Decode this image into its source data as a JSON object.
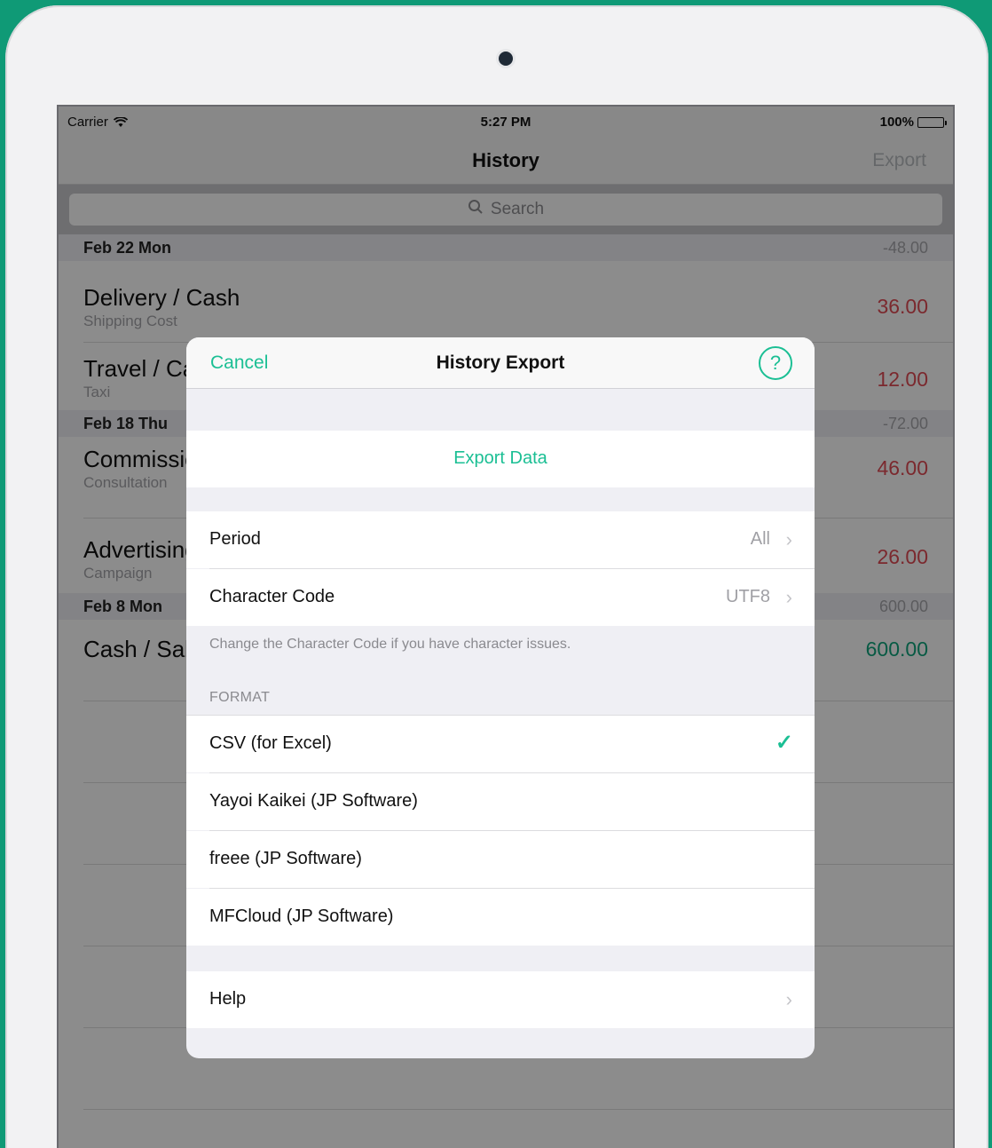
{
  "status_bar": {
    "carrier": "Carrier",
    "time": "5:27 PM",
    "battery": "100%"
  },
  "nav": {
    "title": "History",
    "export_label": "Export"
  },
  "search": {
    "placeholder": "Search"
  },
  "history": {
    "sections": [
      {
        "date": "Feb 22 Mon",
        "sum": "-48.00",
        "rows": [
          {
            "title": "Delivery / Cash",
            "sub": "Shipping Cost",
            "amount": "36.00"
          },
          {
            "title": "Travel / Ca",
            "sub": "Taxi",
            "amount": "12.00"
          }
        ]
      },
      {
        "date": "Feb 18 Thu",
        "sum": "-72.00",
        "rows": [
          {
            "title": "Commissio",
            "sub": "Consultation",
            "amount": "46.00"
          },
          {
            "title": "Advertising",
            "sub": "Campaign",
            "amount": "26.00"
          }
        ]
      },
      {
        "date": "Feb 8 Mon",
        "sum": "600.00",
        "rows": [
          {
            "title": "Cash / Sale",
            "sub": "",
            "amount": "600.00"
          }
        ]
      }
    ]
  },
  "modal": {
    "cancel_label": "Cancel",
    "title": "History Export",
    "help_icon_glyph": "?",
    "export_data_label": "Export Data",
    "period_label": "Period",
    "period_value": "All",
    "char_code_label": "Character Code",
    "char_code_value": "UTF8",
    "char_code_footnote": "Change the Character Code if you have character issues.",
    "format_header": "FORMAT",
    "formats": [
      {
        "label": "CSV (for Excel)",
        "selected": true
      },
      {
        "label": "Yayoi Kaikei (JP Software)",
        "selected": false
      },
      {
        "label": "freee (JP Software)",
        "selected": false
      },
      {
        "label": "MFCloud (JP Software)",
        "selected": false
      }
    ],
    "help_label": "Help"
  },
  "colors": {
    "accent": "#1bbf94",
    "expense": "#e14b55",
    "income": "#10a57c",
    "frame": "#0f9a76"
  }
}
